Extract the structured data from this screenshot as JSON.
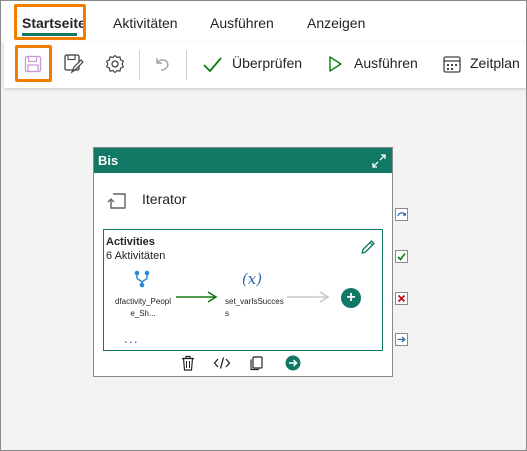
{
  "tabs": [
    {
      "label": "Startseite",
      "active": true
    },
    {
      "label": "Aktivitäten"
    },
    {
      "label": "Ausführen"
    },
    {
      "label": "Anzeigen"
    }
  ],
  "toolbar": {
    "icons": [
      "save-icon",
      "save-as-template-icon",
      "settings-icon",
      "undo-icon"
    ],
    "validate_label": "Überprüfen",
    "run_label": "Ausführen",
    "schedule_label": "Zeitplan"
  },
  "card": {
    "title": "Bis",
    "iterator_label": "Iterator",
    "activities_title": "Activities",
    "activities_count": "6 Aktivitäten",
    "node_a_label": "dfactivity_People_Sh...",
    "node_b_icon": "(x)",
    "node_b_label": "set_varIsSuccess",
    "more": "..."
  },
  "colors": {
    "accent": "#117865",
    "highlight": "#f07c00",
    "success": "#107c10",
    "fail": "#c50f1f",
    "link": "#2b6cb0"
  }
}
